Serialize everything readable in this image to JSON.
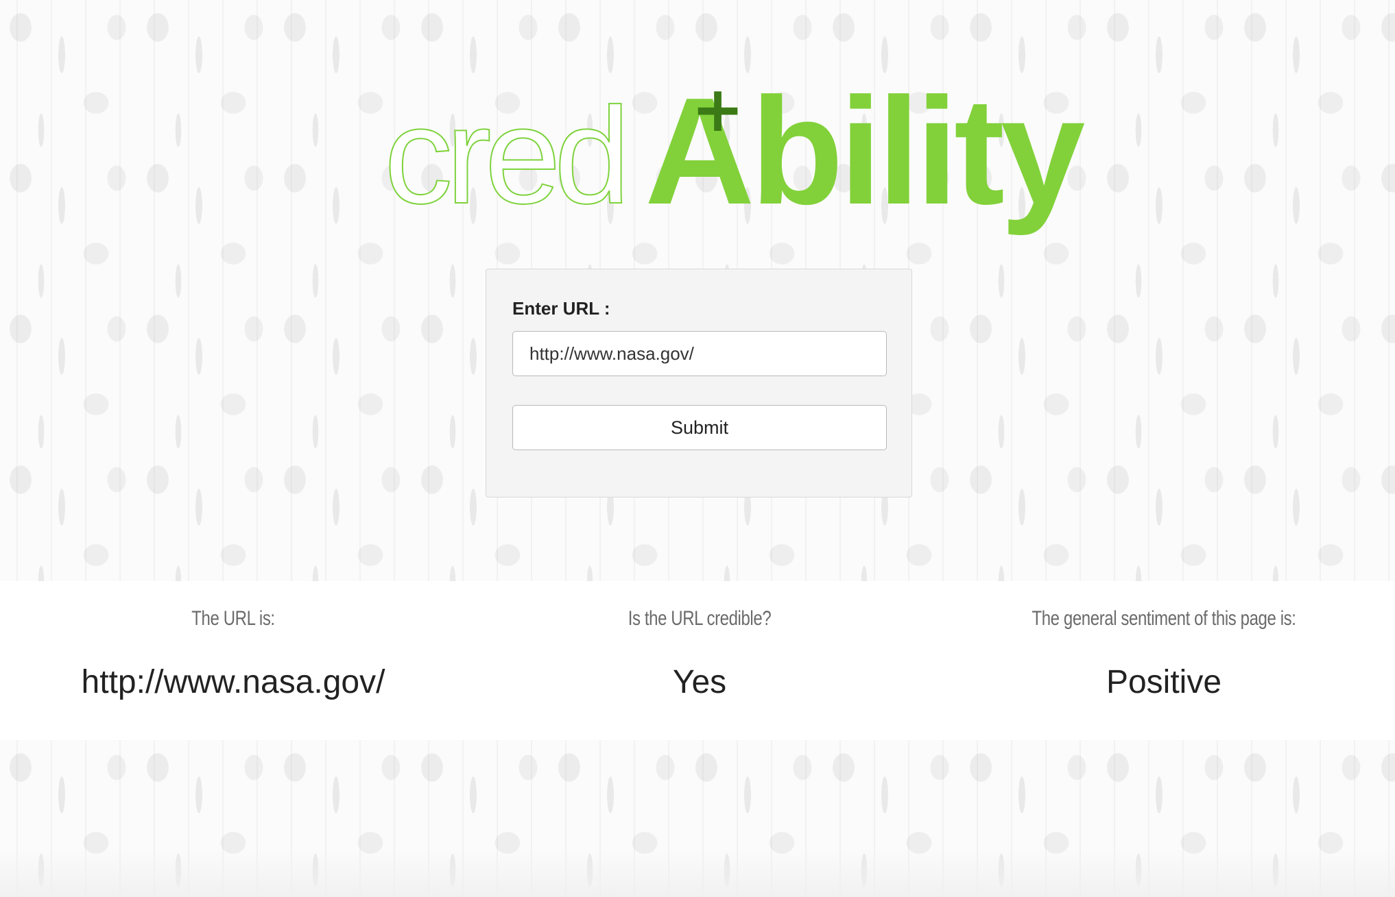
{
  "logo": {
    "prefix": "cred",
    "main": "Ability",
    "plus": "+",
    "colors": {
      "light_green": "#7ed23c",
      "green": "#82d13a",
      "dark_green": "#3b7a16"
    }
  },
  "form": {
    "label": "Enter URL :",
    "url_value": "http://www.nasa.gov/",
    "submit_label": "Submit"
  },
  "results": {
    "url_heading": "The URL is:",
    "url_value": "http://www.nasa.gov/",
    "credible_heading": "Is the URL credible?",
    "credible_value": "Yes",
    "sentiment_heading": "The general sentiment of this page is:",
    "sentiment_value": "Positive"
  }
}
